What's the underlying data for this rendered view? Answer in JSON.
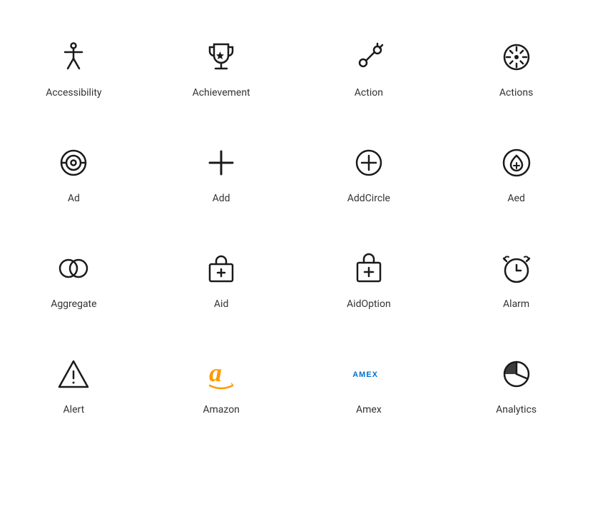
{
  "icons": [
    {
      "id": "accessibility",
      "label": "Accessibility"
    },
    {
      "id": "achievement",
      "label": "Achievement"
    },
    {
      "id": "action",
      "label": "Action"
    },
    {
      "id": "actions",
      "label": "Actions"
    },
    {
      "id": "ad",
      "label": "Ad"
    },
    {
      "id": "add",
      "label": "Add"
    },
    {
      "id": "add-circle",
      "label": "AddCircle"
    },
    {
      "id": "aed",
      "label": "Aed"
    },
    {
      "id": "aggregate",
      "label": "Aggregate"
    },
    {
      "id": "aid",
      "label": "Aid"
    },
    {
      "id": "aid-option",
      "label": "AidOption"
    },
    {
      "id": "alarm",
      "label": "Alarm"
    },
    {
      "id": "alert",
      "label": "Alert"
    },
    {
      "id": "amazon",
      "label": "Amazon"
    },
    {
      "id": "amex",
      "label": "Amex"
    },
    {
      "id": "analytics",
      "label": "Analytics"
    }
  ]
}
